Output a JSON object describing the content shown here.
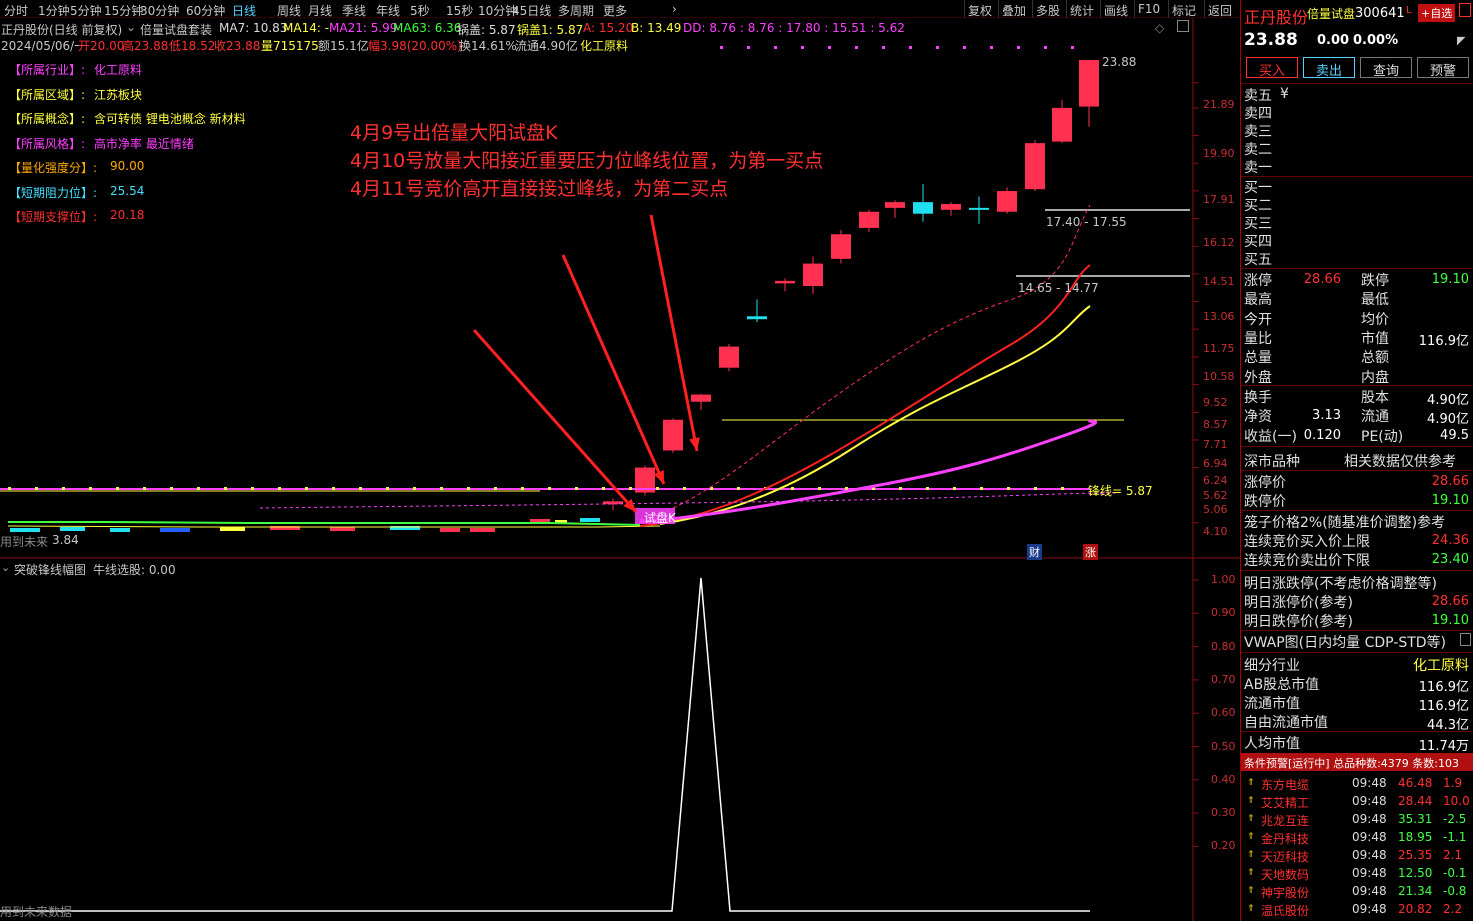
{
  "toolbar": {
    "tabs": [
      "分时",
      "1分钟",
      "5分钟",
      "15分钟",
      "30分钟",
      "60分钟",
      "日线",
      "周线",
      "月线",
      "季线",
      "年线",
      "5秒",
      "15秒",
      "10分钟",
      "45日线",
      "多周期",
      "更多"
    ],
    "active_tab": "日线",
    "right_buttons": [
      "复权",
      "叠加",
      "多股",
      "统计",
      "画线",
      "F10",
      "标记",
      "返回"
    ]
  },
  "header": {
    "stock_title": "正丹股份(日线 前复权)",
    "formula_name": "倍量试盘套装",
    "ma7": "MA7: 10.83",
    "ma14": "MA14: -",
    "ma21": "MA21: 5.99",
    "ma63": "MA63: 6.36",
    "guogai": "锅盖: 5.87",
    "guogai1": "锅盖1: 5.87",
    "a": "A: 15.20",
    "b": "B: 13.49",
    "dd": "DD: 8.76 : 8.76 : 17.80 : 15.51 : 5.62",
    "line2_date": "2024/05/06/一",
    "line2_open": "开20.00",
    "line2_high": "高23.88",
    "line2_low": "低18.52",
    "line2_close": "收23.88",
    "line2_vol": "量715175",
    "line2_amt": "额15.1亿",
    "line2_pct": "幅3.98(20.00%)",
    "line2_turn": "换14.61%",
    "line2_float": "流通4.90亿",
    "line2_ind": "化工原料"
  },
  "info_block": [
    {
      "label": "【所属行业】:",
      "value": "化工原料",
      "color": "#ff40ff",
      "vcolor": "#ff40ff"
    },
    {
      "label": "【所属区域】:",
      "value": "江苏板块",
      "color": "#ffff40",
      "vcolor": "#ffff40"
    },
    {
      "label": "【所属概念】:",
      "value": "含可转债 锂电池概念 新材料",
      "color": "#ffff40",
      "vcolor": "#ffff40"
    },
    {
      "label": "【所属风格】:",
      "value": "高市净率 最近情绪",
      "color": "#ff40ff",
      "vcolor": "#ff40ff"
    },
    {
      "label": "【量化强度分】:",
      "value": "90.00",
      "color": "#ffaa00",
      "vcolor": "#ffaa00"
    },
    {
      "label": "【短期阻力位】:",
      "value": "25.54",
      "color": "#40e0ff",
      "vcolor": "#40e0ff"
    },
    {
      "label": "【短期支撑位】:",
      "value": "20.18",
      "color": "#ff3030",
      "vcolor": "#ff3030"
    }
  ],
  "annotations": [
    "4月9号出倍量大阳试盘K",
    "4月10号放量大阳接近重要压力位峰线位置，为第一买点",
    "4月11号竞价高开直接接过峰线，为第二买点"
  ],
  "chart_labels": {
    "high_label": "23.88",
    "box1": "17.40 - 17.55",
    "box2": "14.65 - 14.77",
    "fengxian": "锋线= 5.87",
    "low_label": "3.84",
    "shipan": "试盘K",
    "cai": "财",
    "zhang": "涨",
    "future1": "用到未来",
    "future2": "用到未来数据"
  },
  "price_axis": [
    "21.89",
    "19.90",
    "17.91",
    "16.12",
    "14.51",
    "13.06",
    "11.75",
    "10.58",
    "9.52",
    "8.57",
    "7.71",
    "6.94",
    "6.24",
    "5.62",
    "5.06",
    "4.10"
  ],
  "sub_panel": {
    "title": "突破锋线幅图",
    "subtitle": "牛线选股: 0.00",
    "axis": [
      "1.00",
      "0.90",
      "0.80",
      "0.70",
      "0.60",
      "0.50",
      "0.40",
      "0.30",
      "0.20"
    ]
  },
  "chart_data": [
    {
      "type": "candlestick",
      "title": "正丹股份(日线 前复权)",
      "candles_approx": [
        {
          "o": 4.4,
          "h": 4.5,
          "l": 4.3,
          "c": 4.45
        },
        {
          "o": 4.6,
          "h": 5.1,
          "l": 4.55,
          "c": 5.06
        },
        {
          "o": 5.4,
          "h": 6.1,
          "l": 5.35,
          "c": 6.07
        },
        {
          "o": 6.5,
          "h": 6.7,
          "l": 6.3,
          "c": 6.68
        },
        {
          "o": 7.4,
          "h": 8.1,
          "l": 7.3,
          "c": 8.02
        },
        {
          "o": 9.0,
          "h": 9.6,
          "l": 8.8,
          "c": 8.9
        },
        {
          "o": 10.2,
          "h": 10.4,
          "l": 9.9,
          "c": 10.3
        },
        {
          "o": 10.1,
          "h": 11.3,
          "l": 9.8,
          "c": 11.0
        },
        {
          "o": 11.2,
          "h": 12.5,
          "l": 11.0,
          "c": 12.3
        },
        {
          "o": 12.6,
          "h": 13.5,
          "l": 12.4,
          "c": 13.4
        },
        {
          "o": 13.6,
          "h": 14.0,
          "l": 13.1,
          "c": 13.9
        },
        {
          "o": 13.9,
          "h": 14.9,
          "l": 12.9,
          "c": 13.3
        },
        {
          "o": 13.5,
          "h": 13.9,
          "l": 13.2,
          "c": 13.8
        },
        {
          "o": 13.6,
          "h": 14.2,
          "l": 12.8,
          "c": 13.5
        },
        {
          "o": 13.4,
          "h": 14.7,
          "l": 13.3,
          "c": 14.5
        },
        {
          "o": 14.6,
          "h": 17.6,
          "l": 14.5,
          "c": 17.4
        },
        {
          "o": 17.5,
          "h": 20.5,
          "l": 17.4,
          "c": 19.9
        },
        {
          "o": 20.0,
          "h": 23.88,
          "l": 18.52,
          "c": 23.88
        }
      ],
      "ylim": [
        3.84,
        23.88
      ],
      "ylabel": "",
      "xlabel": ""
    },
    {
      "type": "line",
      "title": "突破锋线幅图",
      "values": [
        0,
        0,
        0,
        0,
        0,
        0,
        0,
        0,
        0,
        0,
        0,
        0,
        0,
        0,
        0,
        0,
        0,
        0,
        0,
        0,
        0,
        0,
        0,
        1,
        0,
        0,
        0,
        0,
        0,
        0,
        0,
        0,
        0,
        0,
        0,
        0
      ],
      "ylim": [
        0,
        1
      ],
      "ylabel": "",
      "xlabel": ""
    }
  ],
  "right_panel": {
    "name": "正丹股份",
    "formula": "倍量试盘",
    "code": "300641",
    "code_suffix": "L",
    "add_btn": "+自选",
    "price": "23.88",
    "change": "0.00",
    "pct": "0.00%",
    "buttons": [
      "买入",
      "卖出",
      "查询",
      "预警"
    ],
    "sells": [
      "卖五",
      "卖四",
      "卖三",
      "卖二",
      "卖一"
    ],
    "sell5_extra": "¥",
    "buys": [
      "买一",
      "买二",
      "买三",
      "买四",
      "买五"
    ],
    "stats": [
      {
        "l": "涨停",
        "lv": "28.66",
        "r": "跌停",
        "rv": "19.10"
      },
      {
        "l": "最高",
        "lv": "",
        "r": "最低",
        "rv": ""
      },
      {
        "l": "今开",
        "lv": "",
        "r": "均价",
        "rv": ""
      },
      {
        "l": "量比",
        "lv": "",
        "r": "市值",
        "rv": "116.9亿"
      },
      {
        "l": "总量",
        "lv": "",
        "r": "总额",
        "rv": ""
      },
      {
        "l": "外盘",
        "lv": "",
        "r": "内盘",
        "rv": ""
      }
    ],
    "stats2": [
      {
        "l": "换手",
        "lv": "",
        "r": "股本",
        "rv": "4.90亿"
      },
      {
        "l": "净资",
        "lv": "3.13",
        "r": "流通",
        "rv": "4.90亿"
      },
      {
        "l": "收益(一)",
        "lv": "0.120",
        "r": "PE(动)",
        "rv": "49.5"
      }
    ],
    "market": "深市品种",
    "market_note": "相关数据仅供参考",
    "zt_label": "涨停价",
    "zt_value": "28.66",
    "dt_label": "跌停价",
    "dt_value": "19.10",
    "cage": "笼子价格2%(随基准价调整)参考",
    "auction_buy_label": "连续竞价买入价上限",
    "auction_buy_value": "24.36",
    "auction_sell_label": "连续竞价卖出价下限",
    "auction_sell_value": "23.40",
    "next_title": "明日涨跌停(不考虑价格调整等)",
    "next_zt_label": "明日涨停价(参考)",
    "next_zt_value": "28.66",
    "next_dt_label": "明日跌停价(参考)",
    "next_dt_value": "19.10",
    "vwap": "VWAP图(日内均量 CDP-STD等)",
    "industry_label": "细分行业",
    "industry_value": "化工原料",
    "ab_label": "AB股总市值",
    "ab_value": "116.9亿",
    "float_label": "流通市值",
    "float_value": "116.9亿",
    "free_label": "自由流通市值",
    "free_value": "44.3亿",
    "per_label": "人均市值",
    "per_value": "11.74万",
    "warn_bar": "条件预警[运行中] 总品种数:4379 条数:103",
    "warnings": [
      {
        "name": "东方电缆",
        "time": "09:48",
        "price": "46.48",
        "chg": "1.9"
      },
      {
        "name": "艾艾精工",
        "time": "09:48",
        "price": "28.44",
        "chg": "10.0"
      },
      {
        "name": "兆龙互连",
        "time": "09:48",
        "price": "35.31",
        "chg": "-2.5"
      },
      {
        "name": "金丹科技",
        "time": "09:48",
        "price": "18.95",
        "chg": "-1.1"
      },
      {
        "name": "天迈科技",
        "time": "09:48",
        "price": "25.35",
        "chg": "2.1"
      },
      {
        "name": "天地数码",
        "time": "09:48",
        "price": "12.50",
        "chg": "-0.1"
      },
      {
        "name": "神宇股份",
        "time": "09:48",
        "price": "21.34",
        "chg": "-0.8"
      },
      {
        "name": "温氏股份",
        "time": "09:48",
        "price": "20.82",
        "chg": "2.2"
      }
    ]
  }
}
